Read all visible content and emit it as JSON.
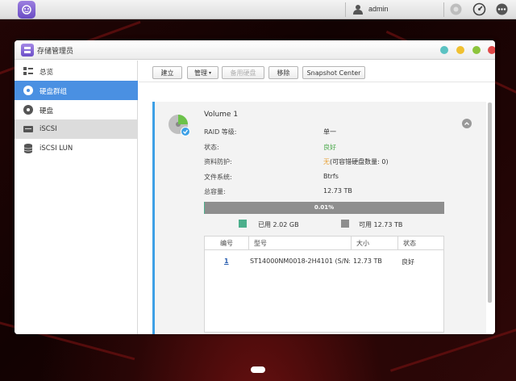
{
  "topbar": {
    "username": "admin",
    "icons": [
      "main-menu-icon",
      "user-icon",
      "notification-icon",
      "dashboard-icon",
      "more-icon"
    ]
  },
  "window": {
    "title": "存储管理员",
    "controls": {
      "colors": [
        "#5bc2c2",
        "#f0c030",
        "#8cc43c",
        "#e04848"
      ]
    }
  },
  "sidebar": {
    "items": [
      {
        "label": "总览",
        "icon": "overview-icon"
      },
      {
        "label": "硬盘群组",
        "icon": "disk-group-icon"
      },
      {
        "label": "硬盘",
        "icon": "disk-icon"
      },
      {
        "label": "iSCSI",
        "icon": "iscsi-icon"
      },
      {
        "label": "iSCSI LUN",
        "icon": "iscsi-lun-icon"
      }
    ]
  },
  "toolbar": {
    "create": "建立",
    "manage": "管理",
    "spare": "备用硬盘",
    "remove": "移除",
    "snapshot": "Snapshot Center"
  },
  "volume": {
    "name": "Volume 1",
    "labels": {
      "raid": "RAID 等级:",
      "status": "状态:",
      "protection": "资料防护:",
      "filesystem": "文件系统:",
      "capacity": "总容量:"
    },
    "values": {
      "raid": "单一",
      "status": "良好",
      "protection_icon": "无",
      "protection_text": "(可容错硬盘数量: 0)",
      "filesystem": "Btrfs",
      "capacity": "12.73 TB"
    },
    "usage": {
      "percent_text": "0.01%",
      "percent": 0.0001,
      "used_label": "已用 2.02 GB",
      "free_label": "可用 12.73 TB",
      "used_color": "#4caf8c",
      "free_color": "#8e8e8e"
    },
    "table": {
      "headers": [
        "编号",
        "型号",
        "大小",
        "状态"
      ],
      "rows": [
        {
          "id": "1",
          "model": "ST14000NM0018-2H4101 (S/N: Z...",
          "size": "12.73 TB",
          "status": "良好"
        }
      ]
    }
  }
}
